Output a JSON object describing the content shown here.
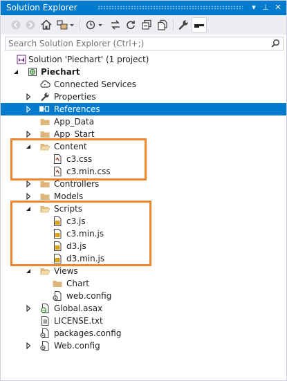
{
  "window": {
    "title": "Solution Explorer",
    "controls": {
      "dropdown": "▾",
      "pin": "⊥",
      "close": "✕"
    }
  },
  "toolbar": {
    "buttons": [
      "back",
      "forward",
      "home",
      "switch-views",
      "pending-changes",
      "sync",
      "refresh",
      "collapse-all",
      "show-all-files",
      "properties",
      "preview"
    ]
  },
  "search": {
    "placeholder": "Search Solution Explorer (Ctrl+;)"
  },
  "tree": {
    "solution": "Solution 'Piechart' (1 project)",
    "project": "Piechart",
    "items": {
      "connected_services": "Connected Services",
      "properties": "Properties",
      "references": "References",
      "app_data": "App_Data",
      "app_start": "App_Start",
      "content": "Content",
      "c3_css": "c3.css",
      "c3_min_css": "c3.min.css",
      "controllers": "Controllers",
      "models": "Models",
      "scripts": "Scripts",
      "c3_js": "c3.js",
      "c3_min_js": "c3.min.js",
      "d3_js": "d3.js",
      "d3_min_js": "d3.min.js",
      "views": "Views",
      "chart": "Chart",
      "views_web_config": "web.config",
      "global_asax": "Global.asax",
      "license": "LICENSE.txt",
      "packages_config": "packages.config",
      "web_config": "Web.config"
    },
    "selected": "references"
  },
  "colors": {
    "accent": "#007acc",
    "highlight": "#f0862f",
    "folder": "#dcb67a",
    "toolbar_bg": "#eeeef2"
  }
}
